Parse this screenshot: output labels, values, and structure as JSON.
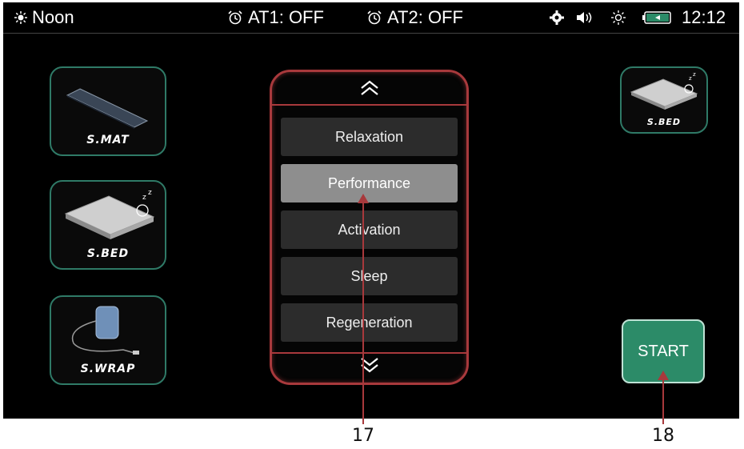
{
  "status_bar": {
    "mode_label": "Noon",
    "alarm1": "AT1: OFF",
    "alarm2": "AT2: OFF",
    "time": "12:12",
    "icons": [
      "sun-icon",
      "alarm-clock-icon",
      "alarm-clock-icon",
      "settings-icon",
      "volume-icon",
      "brightness-icon",
      "battery-icon"
    ]
  },
  "devices": {
    "left": [
      {
        "label": "S.MAT"
      },
      {
        "label": "S.BED"
      },
      {
        "label": "S.WRAP"
      }
    ],
    "right": {
      "label": "S.BED"
    }
  },
  "program_menu": {
    "items": [
      {
        "label": "Relaxation",
        "selected": false
      },
      {
        "label": "Performance",
        "selected": true
      },
      {
        "label": "Activation",
        "selected": false
      },
      {
        "label": "Sleep",
        "selected": false
      },
      {
        "label": "Regeneration",
        "selected": false
      }
    ]
  },
  "start_button": {
    "label": "START"
  },
  "callouts": {
    "menu": "17",
    "start": "18"
  },
  "colors": {
    "accent_red": "#a8393c",
    "accent_green": "#2c8b68",
    "tile_border": "#2f7a67"
  }
}
